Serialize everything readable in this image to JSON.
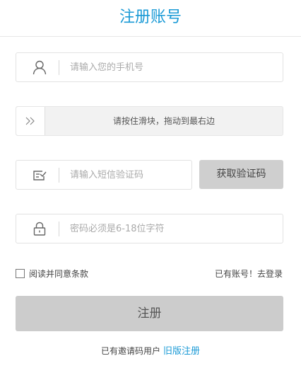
{
  "page_title": "注册账号",
  "phone": {
    "placeholder": "请输入您的手机号",
    "icon": "user-icon"
  },
  "slider": {
    "text": "请按住滑块，拖动到最右边",
    "icon": "double-chevron-right-icon"
  },
  "sms": {
    "placeholder": "请输入短信验证码",
    "icon": "message-check-icon",
    "button_label": "获取验证码"
  },
  "password": {
    "placeholder": "密码必须是6-18位字符",
    "icon": "lock-icon"
  },
  "agreement": {
    "label": "阅读并同意条款",
    "checked": false
  },
  "login_link": "已有账号！去登录",
  "submit_label": "注册",
  "footer": {
    "text": "已有邀请码用户",
    "link": "旧版注册"
  },
  "colors": {
    "accent": "#1a9ad6",
    "button_gray": "#cccccc"
  }
}
